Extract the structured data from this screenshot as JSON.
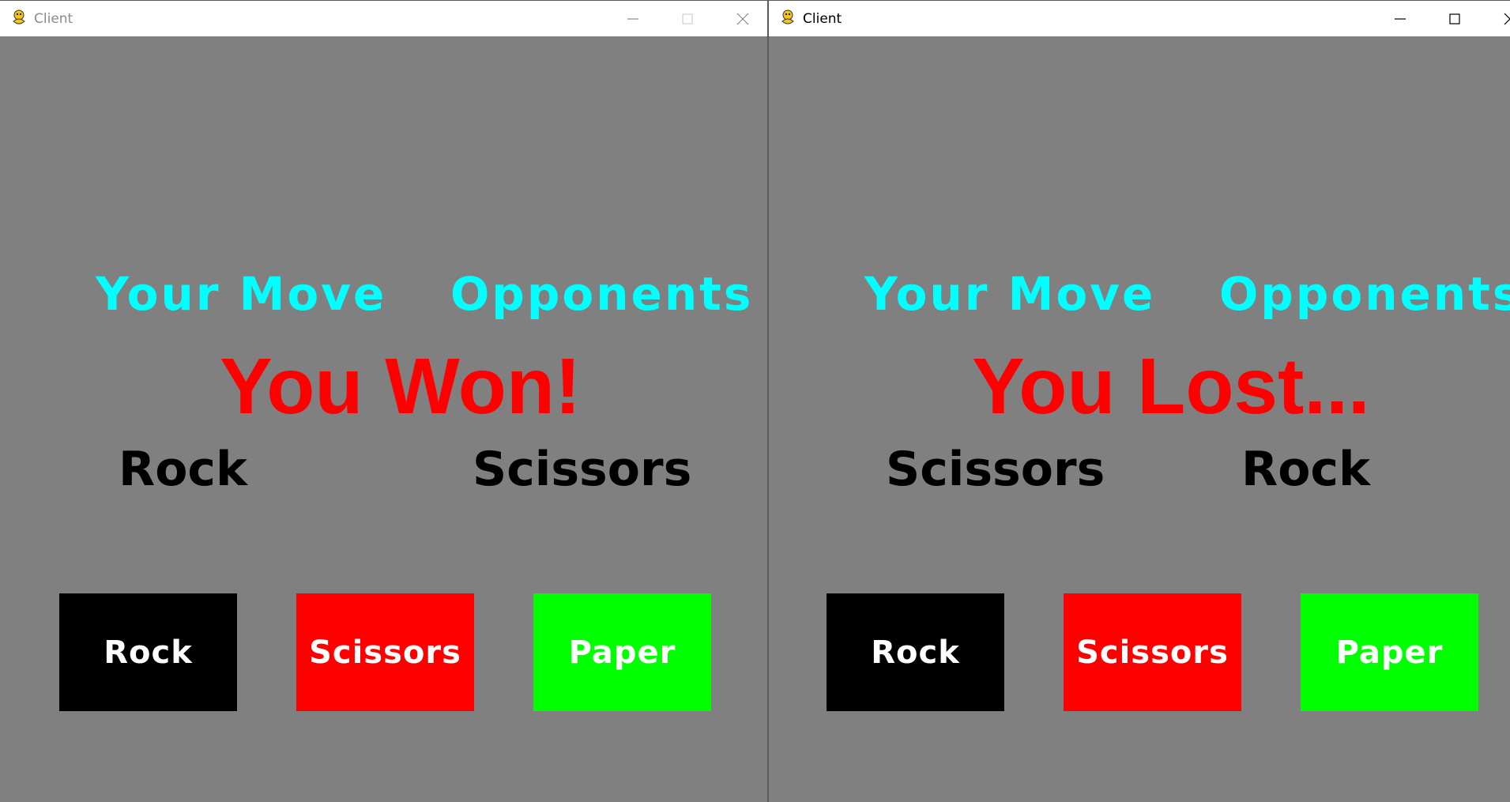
{
  "windows": [
    {
      "title": "Client",
      "headings": {
        "your_move": "Your Move",
        "opponents": "Opponents"
      },
      "result": "You Won!",
      "your_choice": "Rock",
      "opponent_choice": "Scissors",
      "buttons": [
        {
          "label": "Rock",
          "color": "#000000"
        },
        {
          "label": "Scissors",
          "color": "#ff0000"
        },
        {
          "label": "Paper",
          "color": "#00ff00"
        }
      ]
    },
    {
      "title": "Client",
      "headings": {
        "your_move": "Your Move",
        "opponents": "Opponents"
      },
      "result": "You Lost...",
      "your_choice": "Scissors",
      "opponent_choice": "Rock",
      "buttons": [
        {
          "label": "Rock",
          "color": "#000000"
        },
        {
          "label": "Scissors",
          "color": "#ff0000"
        },
        {
          "label": "Paper",
          "color": "#00ff00"
        }
      ]
    }
  ],
  "colors": {
    "background": "#808080",
    "heading": "#00ffff",
    "result": "#ff0000",
    "move_text": "#000000"
  },
  "icons": [
    "pygame-snake-icon",
    "minimize-icon",
    "maximize-icon",
    "close-icon"
  ]
}
